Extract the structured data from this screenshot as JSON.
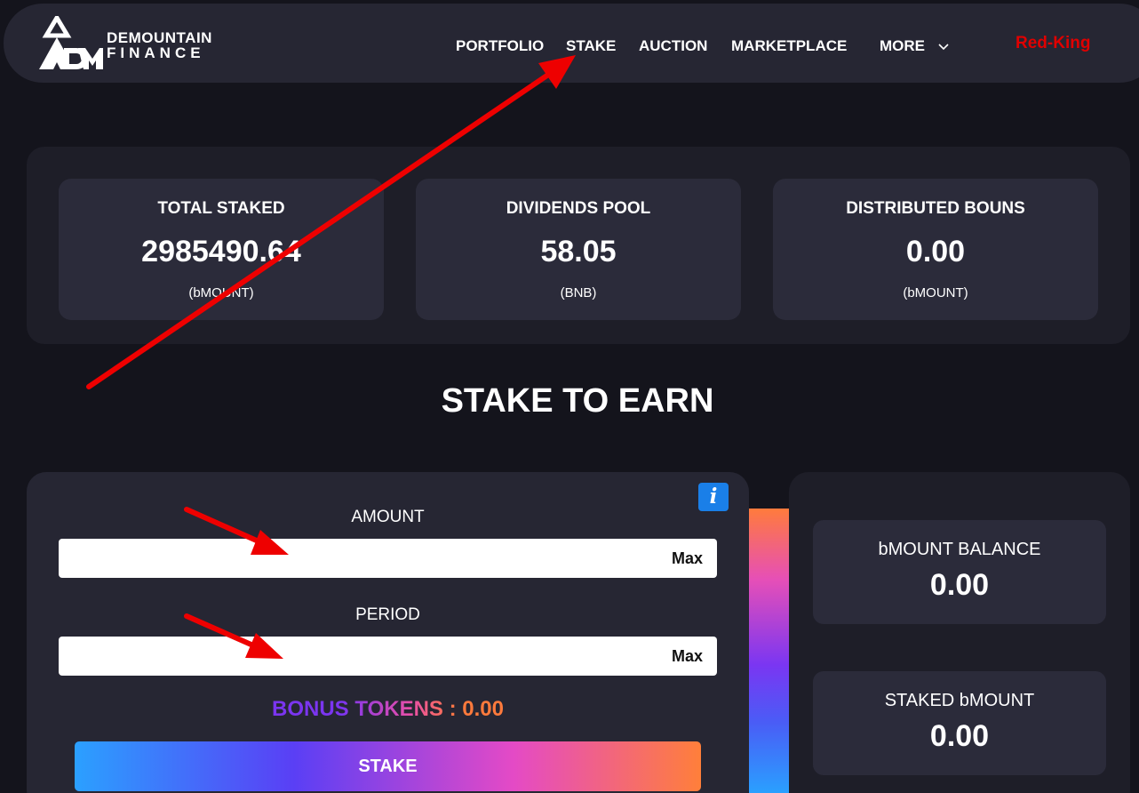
{
  "brand": {
    "name_line1": "DEMOUNTAIN",
    "name_line2": "FINANCE"
  },
  "nav": {
    "items": [
      {
        "label": "PORTFOLIO"
      },
      {
        "label": "STAKE"
      },
      {
        "label": "AUCTION"
      },
      {
        "label": "MARKETPLACE"
      },
      {
        "label": "MORE"
      }
    ],
    "user": "Red-King"
  },
  "stats": [
    {
      "label": "TOTAL STAKED",
      "value": "2985490.64",
      "unit": "(bMOUNT)"
    },
    {
      "label": "DIVIDENDS POOL",
      "value": "58.05",
      "unit": "(BNB)"
    },
    {
      "label": "DISTRIBUTED BOUNS",
      "value": "0.00",
      "unit": "(bMOUNT)"
    }
  ],
  "section_title": "STAKE TO EARN",
  "form": {
    "amount_label": "AMOUNT",
    "amount_value": "",
    "period_label": "PERIOD",
    "period_value": "",
    "max_label": "Max",
    "bonus_text": "BONUS TOKENS : 0.00",
    "stake_button": "STAKE"
  },
  "balances": [
    {
      "label": "bMOUNT BALANCE",
      "value": "0.00"
    },
    {
      "label": "STAKED bMOUNT",
      "value": "0.00"
    }
  ],
  "colors": {
    "background": "#14141c",
    "card": "#2b2b3a",
    "accent_blue": "#1a7fe8",
    "user_red": "#e00000",
    "annotation_red": "#ee0000"
  }
}
